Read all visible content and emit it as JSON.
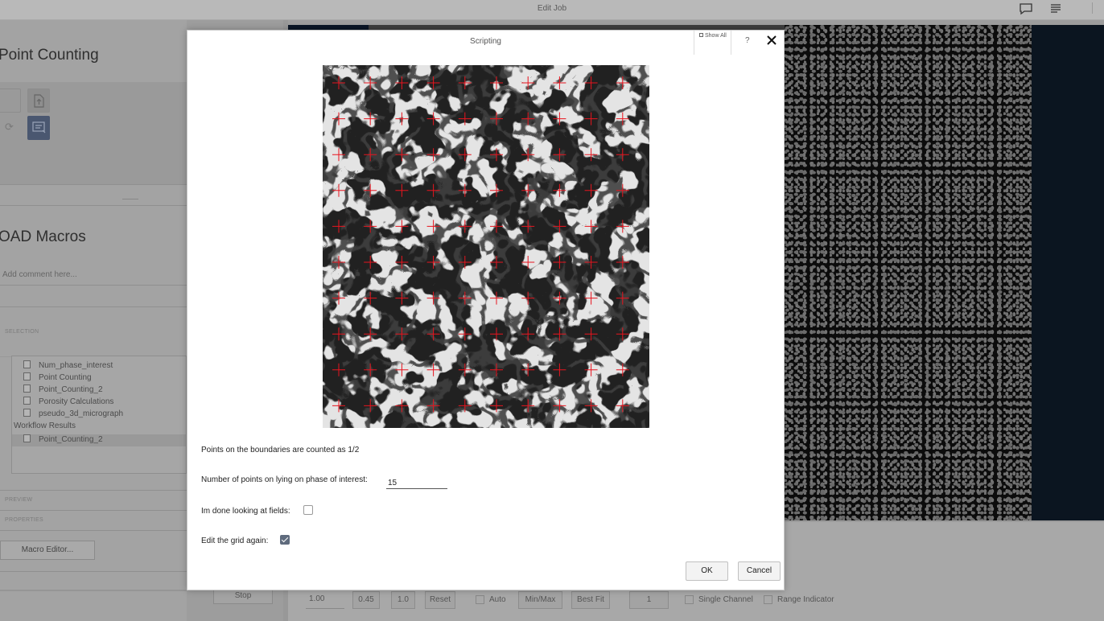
{
  "app": {
    "window_title": "Edit Job",
    "comment_icon": "comment-icon",
    "menu_icon": "menu-icon"
  },
  "left_panel": {
    "heading": "Point Counting",
    "macros_heading": "OAD Macros",
    "comment_placeholder": "Add comment here...",
    "selection_label": "SELECTION",
    "tree_items": [
      "Num_phase_interest",
      "Point Counting",
      "Point_Counting_2",
      "Porosity Calculations",
      "pseudo_3d_micrograph"
    ],
    "workflow_results_label": "Workflow Results",
    "workflow_results_items": [
      "Point_Counting_2"
    ],
    "preview_label": "PREVIEW",
    "properties_label": "PROPERTIES",
    "macro_editor_label": "Macro Editor...",
    "stop_label": "Stop"
  },
  "bottom_bar": {
    "zoom_value": "1.00",
    "gamma_value": "0.45",
    "contrast_value": "1.0",
    "reset_label": "Reset",
    "auto_label": "Auto",
    "minmax_label": "Min/Max",
    "bestfit_label": "Best Fit",
    "channel_value": "1",
    "single_channel_label": "Single Channel",
    "range_indicator_label": "Range Indicator"
  },
  "dialog": {
    "title": "Scripting",
    "show_all_label": "Show All",
    "help_label": "?",
    "close_icon": "close-icon",
    "boundary_note": "Points on the boundaries are counted as 1/2",
    "points_label": "Number of points on lying on phase of interest:",
    "points_value": "15",
    "done_label": "Im done looking at fields:",
    "done_checked": false,
    "edit_grid_label": "Edit the grid again:",
    "edit_grid_checked": true,
    "ok_label": "OK",
    "cancel_label": "Cancel",
    "grid_cross_color": "#e8141e",
    "grid_rows": 10,
    "grid_cols": 10
  }
}
